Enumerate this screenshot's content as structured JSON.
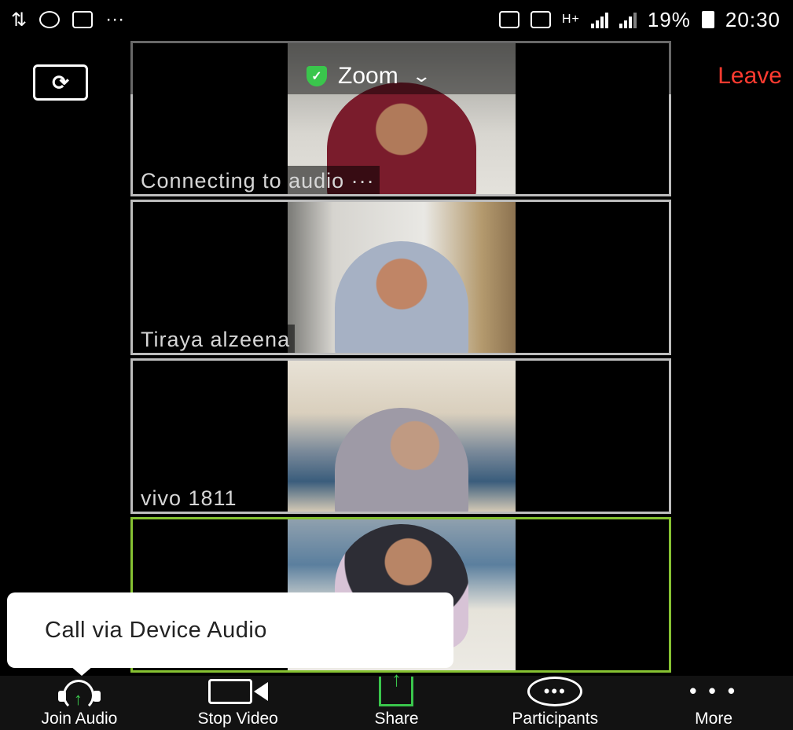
{
  "status_bar": {
    "battery": "19%",
    "time": "20:30"
  },
  "header": {
    "switch_camera_icon": "camera-switch-icon",
    "meeting_title": "Zoom",
    "leave_label": "Leave",
    "accent": "#ff3b30",
    "shield_color": "#3ac64c"
  },
  "tiles": [
    {
      "name": "Connecting to audio ···"
    },
    {
      "name": "Tiraya alzeena"
    },
    {
      "name": "vivo 1811"
    },
    {
      "name": ""
    }
  ],
  "tooltip": {
    "text": "Call via Device Audio"
  },
  "toolbar": {
    "join_audio": "Join Audio",
    "stop_video": "Stop Video",
    "share": "Share",
    "participants": "Participants",
    "more": "More"
  }
}
